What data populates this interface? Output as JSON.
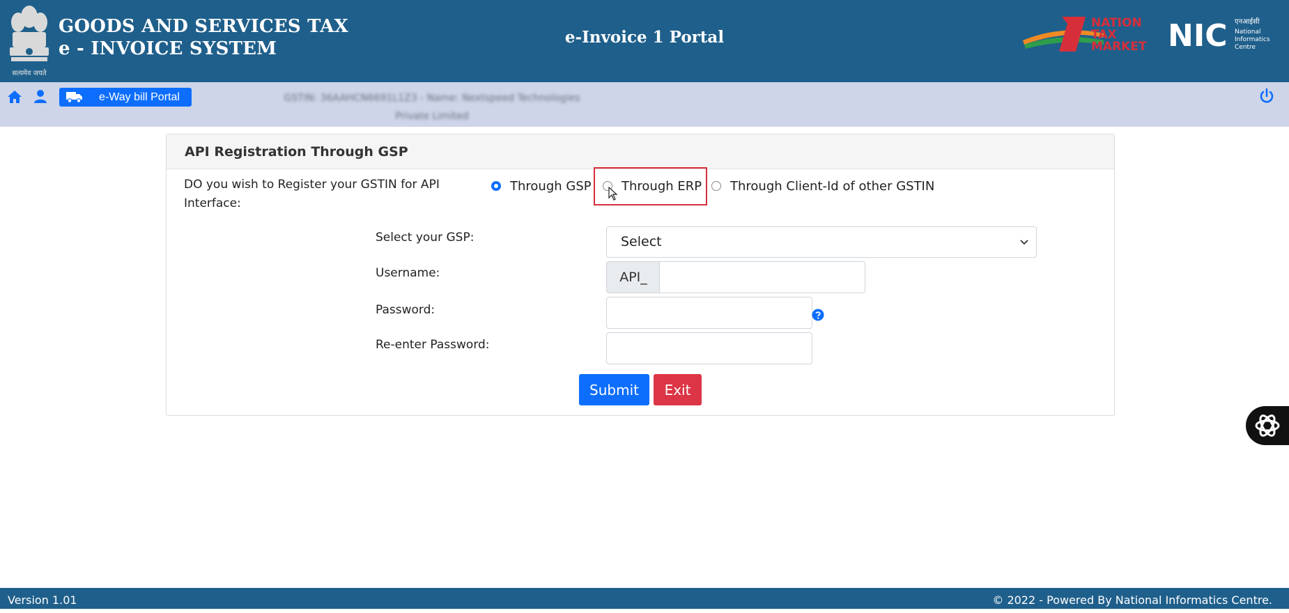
{
  "header": {
    "title_line1": "GOODS AND SERVICES TAX",
    "title_line2": "e - INVOICE SYSTEM",
    "portal": "e-Invoice 1 Portal",
    "emblem_caption": "सत्यमेव जयते",
    "ntm_logo_text": [
      "NATION",
      "TAX",
      "MARKET"
    ],
    "nic_logo": {
      "mark": "NIC",
      "hindi": "एनआईसी",
      "line1": "National",
      "line2": "Informatics",
      "line3": "Centre"
    },
    "colors": {
      "primary": "#1f5f8b",
      "subbar": "#cfd5e9"
    }
  },
  "subbar": {
    "icons": [
      "home-icon",
      "user-icon",
      "power-icon"
    ],
    "eway_label": "e-Way bill Portal",
    "gstin_line1": "GSTIN: 36AAHCN6691L1Z3 - Name: Nextspeed Technologies",
    "gstin_line2": "Private Limited"
  },
  "card": {
    "title": "API Registration Through GSP",
    "question_line1": "DO you wish to Register your GSTIN for API",
    "question_line2": "Interface:",
    "options": [
      {
        "label": "Through GSP",
        "checked": true
      },
      {
        "label": "Through ERP",
        "checked": false
      },
      {
        "label": "Through Client-Id of other GSTIN",
        "checked": false
      }
    ],
    "fields": {
      "gsp_label": "Select your GSP:",
      "gsp_value": "Select",
      "username_label": "Username:",
      "username_prefix": "API_",
      "username_value": "",
      "password_label": "Password:",
      "password_value": "",
      "reenter_label": "Re-enter Password:",
      "reenter_value": ""
    },
    "buttons": {
      "submit": "Submit",
      "exit": "Exit"
    }
  },
  "footer": {
    "version": "Version 1.01",
    "copyright": "© 2022 - Powered By National Informatics Centre."
  }
}
